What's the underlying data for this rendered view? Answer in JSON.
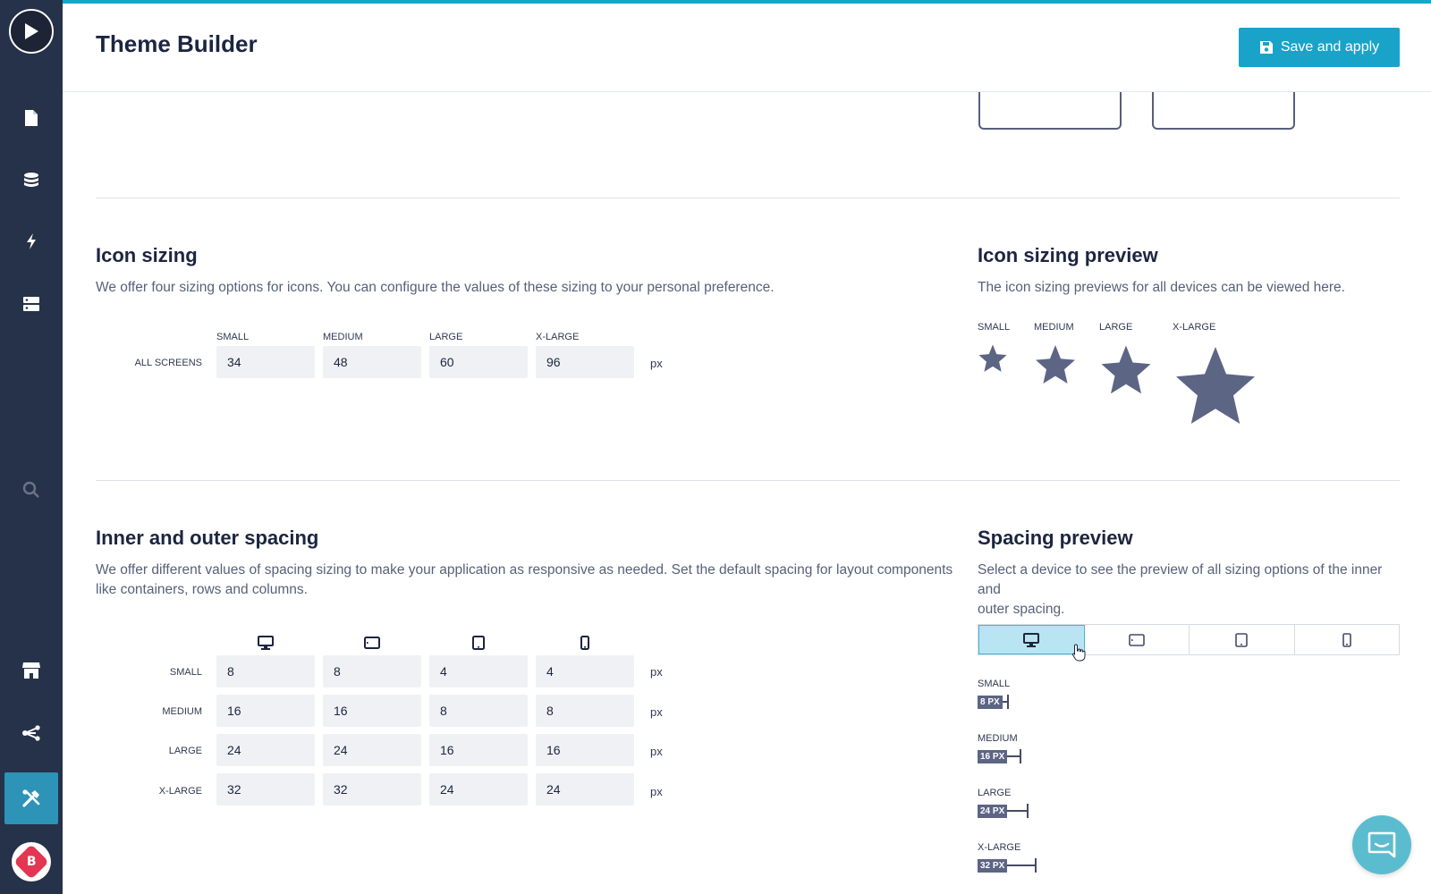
{
  "app": {
    "title": "Theme Builder",
    "accent": "#1aa5cc"
  },
  "header": {
    "save_label": "Save and apply"
  },
  "sidebar": {
    "items": [
      {
        "name": "pages",
        "icon": "file-icon"
      },
      {
        "name": "data",
        "icon": "database-icon"
      },
      {
        "name": "actions",
        "icon": "bolt-icon"
      },
      {
        "name": "models",
        "icon": "server-icon"
      },
      {
        "name": "search",
        "icon": "search-icon"
      },
      {
        "name": "store",
        "icon": "store-icon"
      },
      {
        "name": "share",
        "icon": "share-icon"
      },
      {
        "name": "theme-builder",
        "icon": "tools-icon",
        "active": true
      }
    ],
    "badge": "B"
  },
  "icon_sizing": {
    "title": "Icon sizing",
    "description": "We offer four sizing options for icons. You can configure the values of these sizing to your personal preference.",
    "columns": [
      "SMALL",
      "MEDIUM",
      "LARGE",
      "X-LARGE"
    ],
    "row_label": "ALL SCREENS",
    "values": [
      "34",
      "48",
      "60",
      "96"
    ],
    "unit": "px"
  },
  "icon_preview": {
    "title": "Icon sizing preview",
    "description": "The icon sizing previews for all devices can be viewed here.",
    "labels": [
      "SMALL",
      "MEDIUM",
      "LARGE",
      "X-LARGE"
    ],
    "icon": "star-icon"
  },
  "spacing": {
    "title": "Inner and outer spacing",
    "description_line1": "We offer different values of spacing sizing to make your application as responsive as needed. Set the default spacing for layout components",
    "description_line2": "like containers, rows and columns.",
    "devices": [
      "desktop-icon",
      "tablet-landscape-icon",
      "tablet-portrait-icon",
      "mobile-icon"
    ],
    "rows": [
      {
        "label": "SMALL",
        "values": [
          "8",
          "8",
          "4",
          "4"
        ]
      },
      {
        "label": "MEDIUM",
        "values": [
          "16",
          "16",
          "8",
          "8"
        ]
      },
      {
        "label": "LARGE",
        "values": [
          "24",
          "24",
          "16",
          "16"
        ]
      },
      {
        "label": "X-LARGE",
        "values": [
          "32",
          "32",
          "24",
          "24"
        ]
      }
    ],
    "unit": "px"
  },
  "spacing_preview": {
    "title": "Spacing preview",
    "description_line1": "Select a device to see the preview of all sizing options of the inner and",
    "description_line2": "outer spacing.",
    "selected_device": "desktop",
    "items": [
      {
        "label": "SMALL",
        "tag": "8 PX",
        "value": 8
      },
      {
        "label": "MEDIUM",
        "tag": "16 PX",
        "value": 16
      },
      {
        "label": "LARGE",
        "tag": "24 PX",
        "value": 24
      },
      {
        "label": "X-LARGE",
        "tag": "32 PX",
        "value": 32
      }
    ]
  }
}
